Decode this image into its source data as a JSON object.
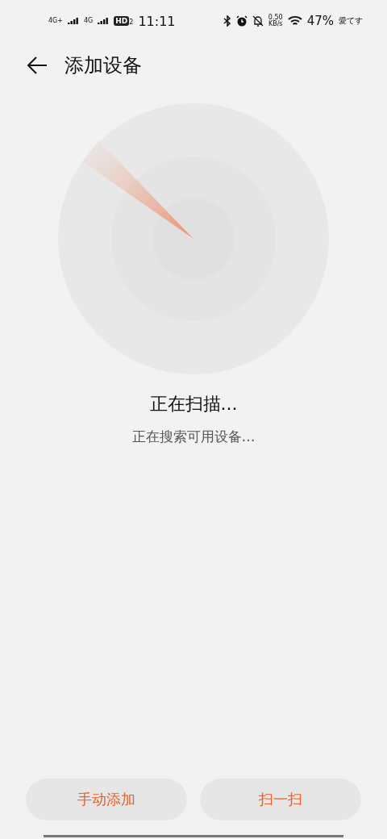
{
  "status_bar": {
    "signal_1": "4G+",
    "signal_2": "4G",
    "hd": "HD",
    "hd_sub": "2",
    "time": "11:11",
    "speed_value": "0.50",
    "speed_unit": "KB/s",
    "battery": "47%",
    "carrier_note": "愛てす"
  },
  "header": {
    "title": "添加设备"
  },
  "scan": {
    "title": "正在扫描...",
    "subtitle": "正在搜索可用设备…"
  },
  "buttons": [
    {
      "label": "手动添加"
    },
    {
      "label": "扫一扫"
    }
  ]
}
